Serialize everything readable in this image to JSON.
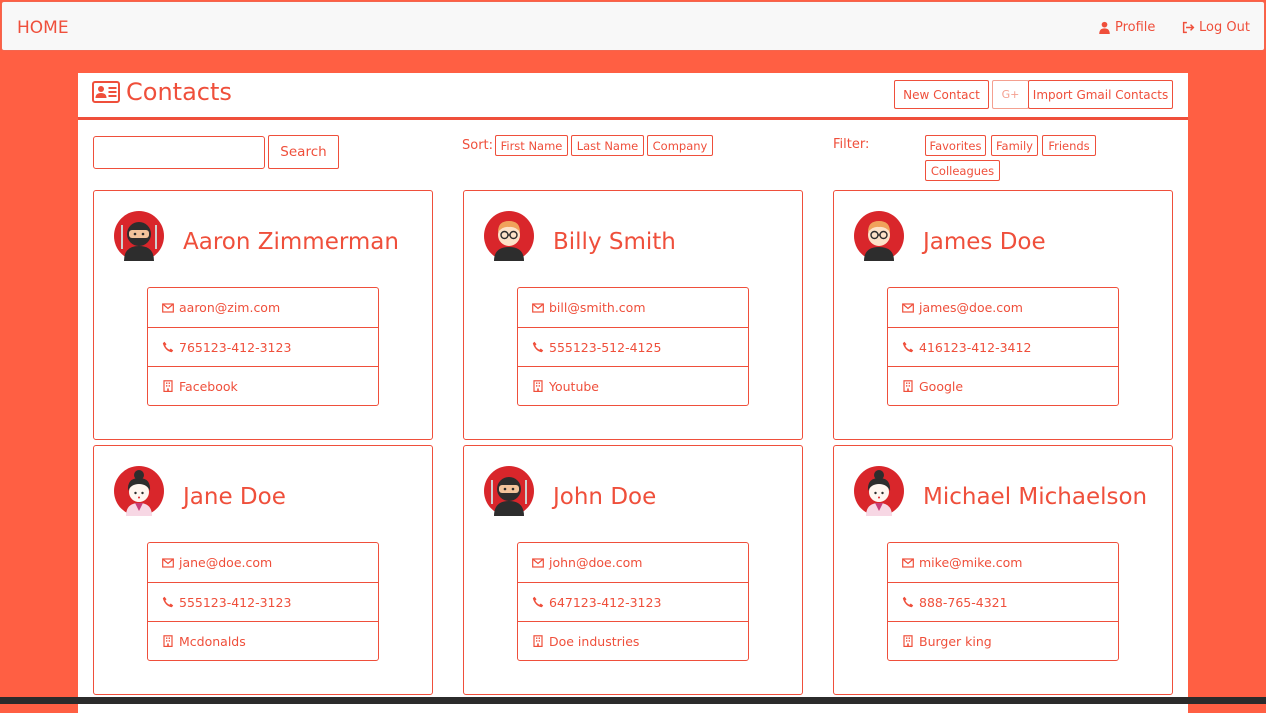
{
  "navbar": {
    "brand": "HOME",
    "profile_label": "Profile",
    "logout_label": "Log Out"
  },
  "panel": {
    "title": "Contacts",
    "new_contact_label": "New Contact",
    "gplus_label": "G+",
    "import_label": "Import Gmail Contacts"
  },
  "toolbar": {
    "search_value": "",
    "search_label": "Search",
    "sort_label": "Sort:",
    "sort_options": [
      "First Name",
      "Last Name",
      "Company"
    ],
    "filter_label": "Filter:",
    "filter_options": [
      "Favorites",
      "Family",
      "Friends",
      "Colleagues"
    ]
  },
  "contacts": [
    {
      "name": "Aaron Zimmerman",
      "avatar": "ninja-avatar-icon",
      "email": "aaron@zim.com",
      "phone": "765123-412-3123",
      "company": "Facebook"
    },
    {
      "name": "Billy Smith",
      "avatar": "glasses-man-avatar-icon",
      "email": "bill@smith.com",
      "phone": "555123-512-4125",
      "company": "Youtube"
    },
    {
      "name": "James Doe",
      "avatar": "glasses-man-avatar-icon",
      "email": "james@doe.com",
      "phone": "416123-412-3412",
      "company": "Google"
    },
    {
      "name": "Jane Doe",
      "avatar": "geisha-avatar-icon",
      "email": "jane@doe.com",
      "phone": "555123-412-3123",
      "company": "Mcdonalds"
    },
    {
      "name": "John Doe",
      "avatar": "ninja-avatar-icon",
      "email": "john@doe.com",
      "phone": "647123-412-3123",
      "company": "Doe industries"
    },
    {
      "name": "Michael Michaelson",
      "avatar": "geisha-avatar-icon",
      "email": "mike@mike.com",
      "phone": "888-765-4321",
      "company": "Burger king"
    }
  ],
  "colors": {
    "accent": "#ef4f3b",
    "background": "#ff5f43",
    "avatar_red": "#d9262b"
  }
}
